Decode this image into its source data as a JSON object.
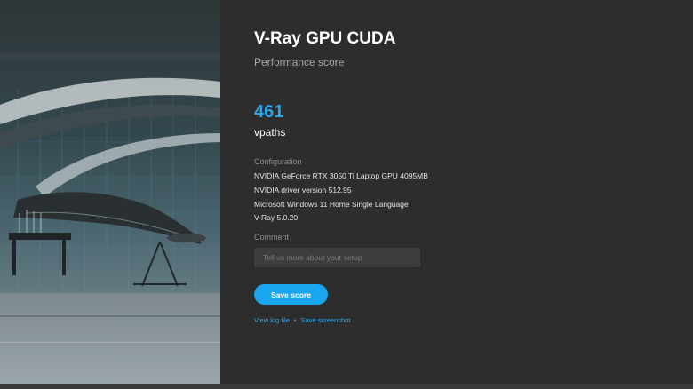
{
  "header": {
    "title": "V-Ray GPU CUDA",
    "subtitle": "Performance score"
  },
  "result": {
    "score": "461",
    "unit": "vpaths"
  },
  "configuration": {
    "label": "Configuration",
    "lines": [
      "NVIDIA GeForce RTX 3050 Ti Laptop GPU 4095MB",
      "NVIDIA driver version 512.95",
      "Microsoft Windows 11 Home Single Language",
      "V-Ray 5.0.20"
    ]
  },
  "comment": {
    "label": "Comment",
    "placeholder": "Tell us more about your setup",
    "value": ""
  },
  "actions": {
    "save_label": "Save score",
    "view_log_label": "View log file",
    "separator": "•",
    "save_screenshot_label": "Save screenshot"
  },
  "colors": {
    "accent": "#1aa6ee",
    "score": "#2fa4e7",
    "background": "#2d2d2d"
  }
}
